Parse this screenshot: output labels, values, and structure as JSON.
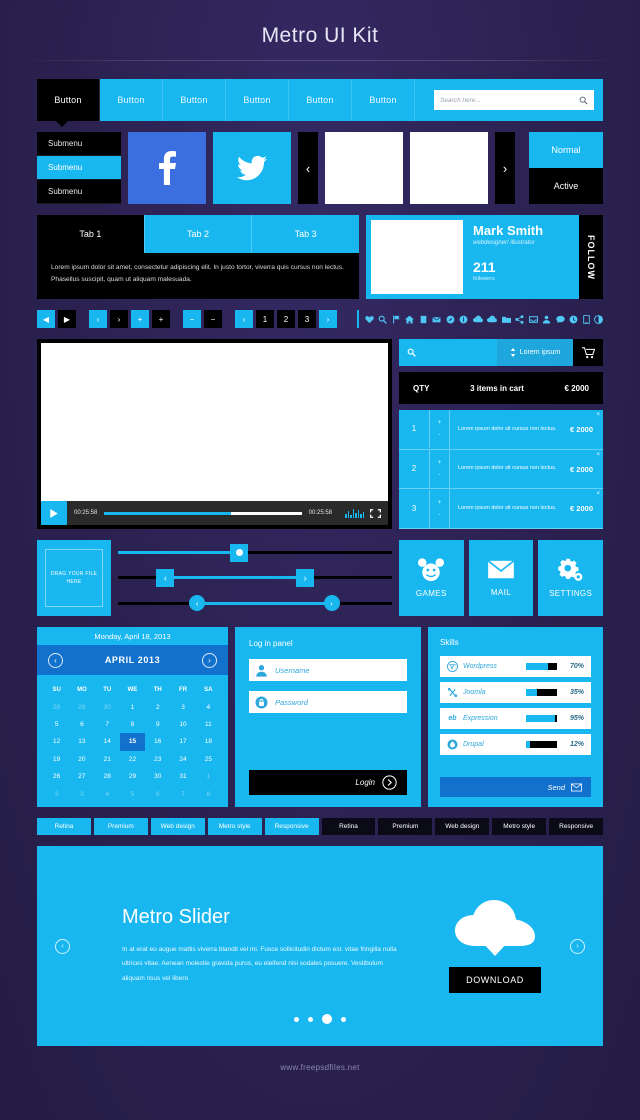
{
  "page": {
    "title": "Metro UI Kit",
    "footer": "www.freepsdfiles.net"
  },
  "colors": {
    "accent": "#18b7f0",
    "dark": "#000000",
    "background": "#2b2150",
    "blue_deep": "#1271cd",
    "facebook": "#3b6fe0"
  },
  "navbar": {
    "buttons": [
      {
        "label": "Button",
        "state": "active"
      },
      {
        "label": "Button",
        "state": "normal"
      },
      {
        "label": "Button",
        "state": "normal"
      },
      {
        "label": "Button",
        "state": "normal"
      },
      {
        "label": "Button",
        "state": "normal"
      },
      {
        "label": "Button",
        "state": "normal"
      }
    ],
    "search": {
      "placeholder": "Search here...",
      "icon": "search-icon"
    }
  },
  "submenu": {
    "items": [
      {
        "label": "Submenu",
        "selected": false
      },
      {
        "label": "Submenu",
        "selected": true
      },
      {
        "label": "Submenu",
        "selected": false
      }
    ]
  },
  "social": {
    "facebook": "facebook-icon",
    "twitter": "twitter-icon"
  },
  "carousel": {
    "prev": "‹",
    "next": "›"
  },
  "states": {
    "normal": "Normal",
    "active": "Active"
  },
  "tabs": {
    "items": [
      {
        "label": "Tab 1",
        "active": true
      },
      {
        "label": "Tab 2",
        "active": false
      },
      {
        "label": "Tab 3",
        "active": false
      }
    ],
    "content": "Lorem ipsum dolor sit amet, consectetur adipiscing elit. In justo tortor, viverra quis cursus non lectus. Phasellus suscipit, quam ut aliquam malesuada."
  },
  "profile": {
    "name": "Mark Smith",
    "role": "webdesigner/ illustrator",
    "count": "211",
    "count_label": "followers",
    "follow": "FOLLOW"
  },
  "pagination": {
    "groups": [
      [
        {
          "label": "◀",
          "style": "blue"
        },
        {
          "label": "▶",
          "style": "dark"
        }
      ],
      [
        {
          "label": "‹",
          "style": "blue"
        },
        {
          "label": "›",
          "style": "dark"
        }
      ],
      [
        {
          "label": "+",
          "style": "blue"
        },
        {
          "label": "+",
          "style": "dark"
        }
      ],
      [
        {
          "label": "−",
          "style": "blue"
        },
        {
          "label": "−",
          "style": "dark"
        }
      ],
      [
        {
          "label": "‹",
          "style": "blue"
        },
        {
          "label": "1",
          "style": "dark"
        },
        {
          "label": "2",
          "style": "dark"
        },
        {
          "label": "3",
          "style": "dark"
        },
        {
          "label": "›",
          "style": "blue"
        }
      ]
    ]
  },
  "icon_row": {
    "icons": [
      "heart-icon",
      "search-icon",
      "flag-icon",
      "home-icon",
      "book-icon",
      "mail-icon",
      "compass-icon",
      "info-icon",
      "cloud-icon",
      "cloud-upload-icon",
      "folder-icon",
      "share-icon",
      "inbox-icon",
      "user-icon",
      "comment-icon",
      "clock-icon",
      "mobile-icon",
      "contrast-icon"
    ]
  },
  "video": {
    "play": "play-icon",
    "time_elapsed": "00:25:58",
    "time_total": "00:25:58",
    "progress_pct": 64,
    "volume_icon": "equalizer-icon",
    "fullscreen_icon": "fullscreen-icon"
  },
  "shop": {
    "search_placeholder": "",
    "search_icon": "search-icon",
    "select_label": "Lorem ipsum",
    "select_icon": "sort-icon",
    "cart_icon": "cart-icon",
    "header": {
      "qty": "QTY",
      "items": "3 items in cart",
      "total": "€ 2000"
    },
    "rows": [
      {
        "n": "1",
        "desc": "Lorem ipsum dolor sit cursus non lectus.",
        "price": "€ 2000"
      },
      {
        "n": "2",
        "desc": "Lorem ipsum dolor sit cursus non lectus.",
        "price": "€ 2000"
      },
      {
        "n": "3",
        "desc": "Lorem ipsum dolor sit cursus non lectus.",
        "price": "€ 2000"
      }
    ],
    "remove": "×",
    "inc": "+",
    "dec": "-"
  },
  "dropzone": {
    "label": "DRAG YOUR FILE HERE"
  },
  "sliders": [
    {
      "style": "square-knob",
      "value_pct": 44
    },
    {
      "style": "range-square",
      "start_pct": 16,
      "end_pct": 67
    },
    {
      "style": "range-round",
      "start_pct": 28,
      "end_pct": 78
    }
  ],
  "tiles": [
    {
      "label": "GAMES",
      "icon": "mickey-icon"
    },
    {
      "label": "MAIL",
      "icon": "envelope-icon"
    },
    {
      "label": "SETTINGS",
      "icon": "gear-icon"
    }
  ],
  "calendar": {
    "today": "Monday, April 18, 2013",
    "month": "APRIL 2013",
    "prev": "‹",
    "next": "›",
    "dow": [
      "SU",
      "MO",
      "TU",
      "WE",
      "TH",
      "FR",
      "SA"
    ],
    "weeks": [
      [
        {
          "d": "28",
          "m": true
        },
        {
          "d": "29",
          "m": true
        },
        {
          "d": "30",
          "m": true
        },
        {
          "d": "1"
        },
        {
          "d": "2"
        },
        {
          "d": "3"
        },
        {
          "d": "4"
        }
      ],
      [
        {
          "d": "5"
        },
        {
          "d": "6"
        },
        {
          "d": "7"
        },
        {
          "d": "8"
        },
        {
          "d": "9"
        },
        {
          "d": "10"
        },
        {
          "d": "11"
        }
      ],
      [
        {
          "d": "12"
        },
        {
          "d": "13"
        },
        {
          "d": "14"
        },
        {
          "d": "15",
          "sel": true
        },
        {
          "d": "16"
        },
        {
          "d": "17"
        },
        {
          "d": "18"
        }
      ],
      [
        {
          "d": "19"
        },
        {
          "d": "20"
        },
        {
          "d": "21"
        },
        {
          "d": "22"
        },
        {
          "d": "23"
        },
        {
          "d": "24"
        },
        {
          "d": "25"
        }
      ],
      [
        {
          "d": "26"
        },
        {
          "d": "27"
        },
        {
          "d": "28"
        },
        {
          "d": "29"
        },
        {
          "d": "30"
        },
        {
          "d": "31"
        },
        {
          "d": "1",
          "m": true
        }
      ],
      [
        {
          "d": "2",
          "m": true
        },
        {
          "d": "3",
          "m": true
        },
        {
          "d": "4",
          "m": true
        },
        {
          "d": "5",
          "m": true
        },
        {
          "d": "6",
          "m": true
        },
        {
          "d": "7",
          "m": true
        },
        {
          "d": "8",
          "m": true
        }
      ]
    ]
  },
  "login": {
    "title": "Log in panel",
    "username_placeholder": "Username",
    "username_icon": "user-icon",
    "password_placeholder": "Password",
    "password_icon": "lock-icon",
    "button": "Login",
    "button_icon": "chevron-right-icon"
  },
  "skills": {
    "title": "Skills",
    "items": [
      {
        "name": "Wordpress",
        "pct": "70%",
        "value": 70,
        "icon": "wordpress-icon"
      },
      {
        "name": "Joomla",
        "pct": "35%",
        "value": 35,
        "icon": "joomla-icon"
      },
      {
        "name": "Expression",
        "pct": "95%",
        "value": 95,
        "icon": "expression-icon"
      },
      {
        "name": "Drupal",
        "pct": "12%",
        "value": 12,
        "icon": "drupal-icon"
      }
    ],
    "send": "Send",
    "send_icon": "envelope-icon"
  },
  "tags": [
    {
      "label": "Retina",
      "style": "blue"
    },
    {
      "label": "Premium",
      "style": "blue"
    },
    {
      "label": "Web design",
      "style": "blue"
    },
    {
      "label": "Metro style",
      "style": "blue"
    },
    {
      "label": "Responsive",
      "style": "blue"
    },
    {
      "label": "Retina",
      "style": "dark"
    },
    {
      "label": "Premium",
      "style": "dark"
    },
    {
      "label": "Web design",
      "style": "dark"
    },
    {
      "label": "Metro style",
      "style": "dark"
    },
    {
      "label": "Responsive",
      "style": "dark"
    }
  ],
  "metro_slider": {
    "title": "Metro Slider",
    "text": "In at erat eu augue mattis viverra blandit vel mi. Fusce sollicitudin dictum est. vitae fringilla nulla ultrices vitae. Aenean molestie gravida purus, eu eleifend nisi sodales posuere. Vestibulum aliquam risus vel libero",
    "download": "DOWNLOAD",
    "cloud_icon": "cloud-download-icon",
    "prev": "‹",
    "next": "›",
    "dots": 4,
    "active_dot": 3
  }
}
